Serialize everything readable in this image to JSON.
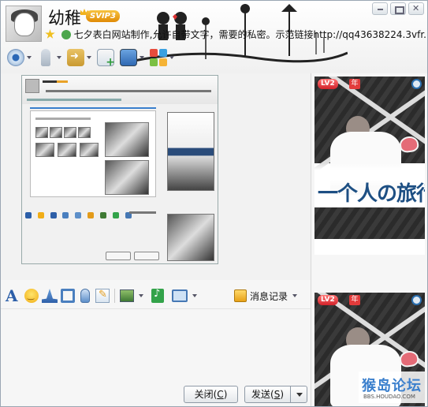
{
  "header": {
    "nickname": "幼稚",
    "vip_label": "SVIP3",
    "signature": "七夕表白网站制作,允许自带文字，需要的私密。示范链接http://qq43638224.3vfr..."
  },
  "window_controls": [
    "minimize",
    "maximize",
    "close"
  ],
  "top_toolbar": {
    "icons": [
      "camera-icon",
      "microphone-icon",
      "send-file-icon",
      "create-discussion-icon",
      "remote-assist-icon",
      "apps-icon"
    ]
  },
  "format_toolbar": {
    "font_glyph": "A",
    "message_history_label": "消息记录"
  },
  "show_panel": {
    "level_badge": "LV2",
    "year_badge": "年",
    "photo_caption": "一个人の旅行",
    "watermark": "猴岛论坛",
    "watermark_url": "BBS.HOUDAO.COM"
  },
  "buttons": {
    "close_label": "关闭(",
    "close_key": "C",
    "close_suffix": ")",
    "send_label": "发送(",
    "send_key": "S",
    "send_suffix": ")"
  },
  "colors": {
    "accent": "#2b5ea8",
    "vip": "#e08a06",
    "level_badge": "#d1222a"
  }
}
